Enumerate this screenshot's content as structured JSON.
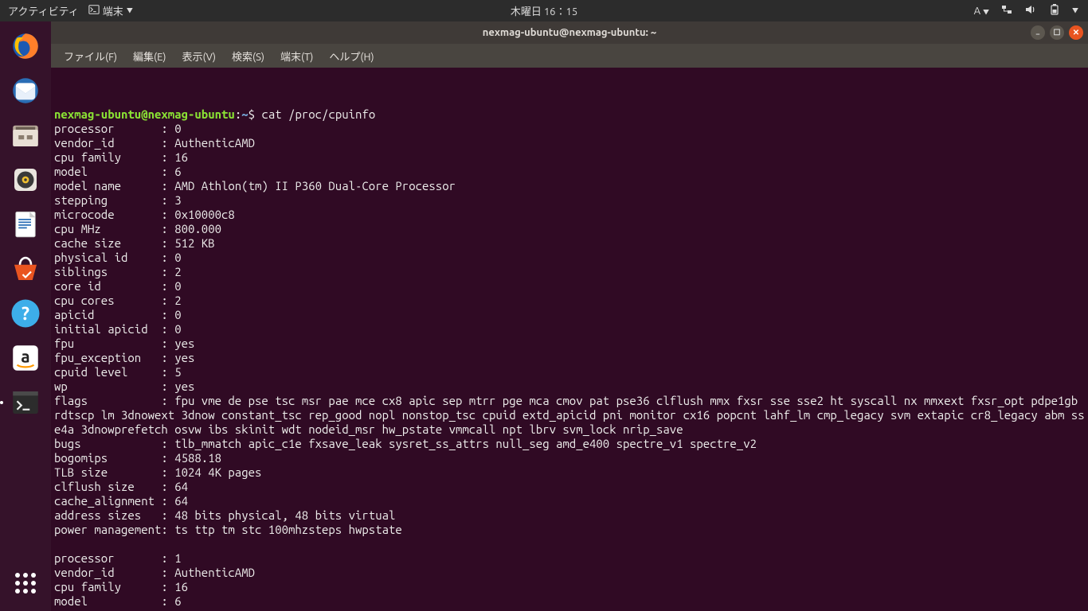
{
  "top_panel": {
    "activities": "アクティビティ",
    "app_indicator": "端末",
    "clock": "木曜日 16：15",
    "input_method": "A"
  },
  "window": {
    "title": "nexmag-ubuntu@nexmag-ubuntu: ~"
  },
  "menubar": {
    "file": "ファイル(F)",
    "edit": "編集(E)",
    "view": "表示(V)",
    "search": "検索(S)",
    "terminal": "端末(T)",
    "help": "ヘルプ(H)"
  },
  "terminal": {
    "prompt_user": "nexmag-ubuntu@nexmag-ubuntu",
    "prompt_sep1": ":",
    "prompt_path": "~",
    "prompt_end": "$ ",
    "command": "cat /proc/cpuinfo",
    "output": "processor       : 0\nvendor_id       : AuthenticAMD\ncpu family      : 16\nmodel           : 6\nmodel name      : AMD Athlon(tm) II P360 Dual-Core Processor\nstepping        : 3\nmicrocode       : 0x10000c8\ncpu MHz         : 800.000\ncache size      : 512 KB\nphysical id     : 0\nsiblings        : 2\ncore id         : 0\ncpu cores       : 2\napicid          : 0\ninitial apicid  : 0\nfpu             : yes\nfpu_exception   : yes\ncpuid level     : 5\nwp              : yes\nflags           : fpu vme de pse tsc msr pae mce cx8 apic sep mtrr pge mca cmov pat pse36 clflush mmx fxsr sse sse2 ht syscall nx mmxext fxsr_opt pdpe1gb rdtscp lm 3dnowext 3dnow constant_tsc rep_good nopl nonstop_tsc cpuid extd_apicid pni monitor cx16 popcnt lahf_lm cmp_legacy svm extapic cr8_legacy abm sse4a 3dnowprefetch osvw ibs skinit wdt nodeid_msr hw_pstate vmmcall npt lbrv svm_lock nrip_save\nbugs            : tlb_mmatch apic_c1e fxsave_leak sysret_ss_attrs null_seg amd_e400 spectre_v1 spectre_v2\nbogomips        : 4588.18\nTLB size        : 1024 4K pages\nclflush size    : 64\ncache_alignment : 64\naddress sizes   : 48 bits physical, 48 bits virtual\npower management: ts ttp tm stc 100mhzsteps hwpstate\n\nprocessor       : 1\nvendor_id       : AuthenticAMD\ncpu family      : 16\nmodel           : 6"
  }
}
